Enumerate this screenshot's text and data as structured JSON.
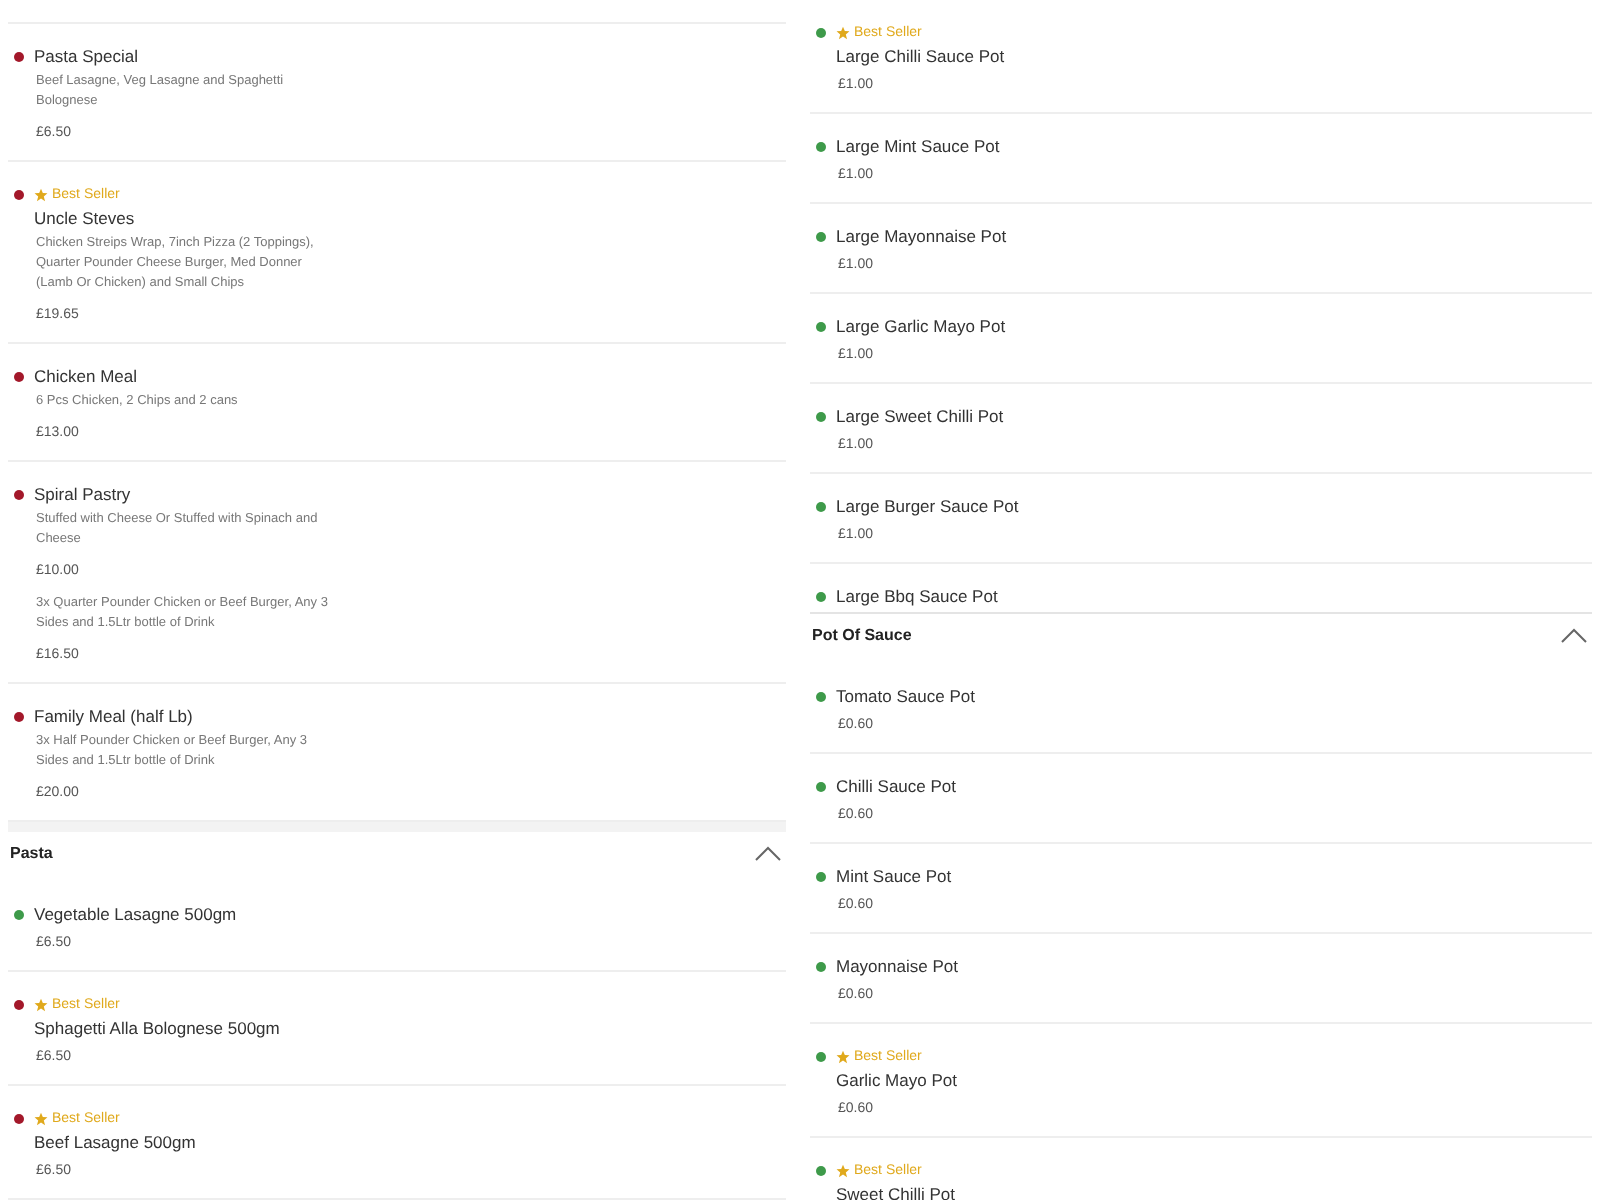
{
  "columns": [
    {
      "sections": [
        {
          "items": [
            {
              "name": "Pasta Special",
              "color": "#a3182a",
              "offers": [
                {
                  "description": "Beef Lasagne, Veg Lasagne and Spaghetti Bolognese",
                  "price": "£6.50"
                }
              ]
            },
            {
              "name": "Uncle Steves",
              "color": "#a3182a",
              "badge": "Best Seller",
              "offers": [
                {
                  "description": "Chicken Streips Wrap, 7inch Pizza (2 Toppings), Quarter Pounder Cheese Burger, Med Donner (Lamb Or Chicken) and Small Chips",
                  "price": "£19.65"
                }
              ]
            },
            {
              "name": "Chicken Meal",
              "color": "#a3182a",
              "offers": [
                {
                  "description": "6 Pcs Chicken, 2 Chips and 2 cans",
                  "price": "£13.00"
                }
              ]
            },
            {
              "name": "Spiral Pastry",
              "color": "#a3182a",
              "offers": [
                {
                  "description": "Stuffed with Cheese Or Stuffed with Spinach and Cheese",
                  "price": "£10.00"
                },
                {
                  "description": "3x Quarter Pounder Chicken or Beef Burger, Any 3 Sides and 1.5Ltr bottle of Drink",
                  "price": "£16.50"
                }
              ]
            },
            {
              "name": "Family Meal (half Lb)",
              "color": "#a3182a",
              "offers": [
                {
                  "description": "3x Half Pounder Chicken or Beef Burger, Any 3 Sides and 1.5Ltr bottle of Drink",
                  "price": "£20.00"
                }
              ]
            }
          ]
        },
        {
          "title": "Pasta",
          "expanded": true,
          "items": [
            {
              "name": "Vegetable Lasagne 500gm",
              "color": "#3e9a4a",
              "offers": [
                {
                  "price": "£6.50"
                }
              ]
            },
            {
              "name": "Sphagetti Alla Bolognese 500gm",
              "color": "#a3182a",
              "badge": "Best Seller",
              "offers": [
                {
                  "price": "£6.50"
                }
              ]
            },
            {
              "name": "Beef Lasagne 500gm",
              "color": "#a3182a",
              "badge": "Best Seller",
              "offers": [
                {
                  "price": "£6.50"
                }
              ]
            }
          ]
        }
      ]
    },
    {
      "sections": [
        {
          "items": [
            {
              "name": "Large Chilli Sauce Pot",
              "color": "#3e9a4a",
              "badge": "Best Seller",
              "offers": [
                {
                  "price": "£1.00"
                }
              ]
            },
            {
              "name": "Large Mint Sauce Pot",
              "color": "#3e9a4a",
              "offers": [
                {
                  "price": "£1.00"
                }
              ]
            },
            {
              "name": "Large Mayonnaise Pot",
              "color": "#3e9a4a",
              "offers": [
                {
                  "price": "£1.00"
                }
              ]
            },
            {
              "name": "Large Garlic Mayo Pot",
              "color": "#3e9a4a",
              "offers": [
                {
                  "price": "£1.00"
                }
              ]
            },
            {
              "name": "Large Sweet Chilli Pot",
              "color": "#3e9a4a",
              "offers": [
                {
                  "price": "£1.00"
                }
              ]
            },
            {
              "name": "Large Burger Sauce Pot",
              "color": "#3e9a4a",
              "offers": [
                {
                  "price": "£1.00"
                }
              ]
            },
            {
              "name": "Large Bbq Sauce Pot",
              "color": "#3e9a4a"
            }
          ]
        },
        {
          "title": "Pot Of Sauce",
          "expanded": true,
          "items": [
            {
              "name": "Tomato Sauce Pot",
              "color": "#3e9a4a",
              "offers": [
                {
                  "price": "£0.60"
                }
              ]
            },
            {
              "name": "Chilli Sauce Pot",
              "color": "#3e9a4a",
              "offers": [
                {
                  "price": "£0.60"
                }
              ]
            },
            {
              "name": "Mint Sauce Pot",
              "color": "#3e9a4a",
              "offers": [
                {
                  "price": "£0.60"
                }
              ]
            },
            {
              "name": "Mayonnaise Pot",
              "color": "#3e9a4a",
              "offers": [
                {
                  "price": "£0.60"
                }
              ]
            },
            {
              "name": "Garlic Mayo Pot",
              "color": "#3e9a4a",
              "badge": "Best Seller",
              "offers": [
                {
                  "price": "£0.60"
                }
              ]
            },
            {
              "name": "Sweet Chilli Pot",
              "color": "#3e9a4a",
              "badge": "Best Seller"
            }
          ]
        }
      ]
    }
  ]
}
